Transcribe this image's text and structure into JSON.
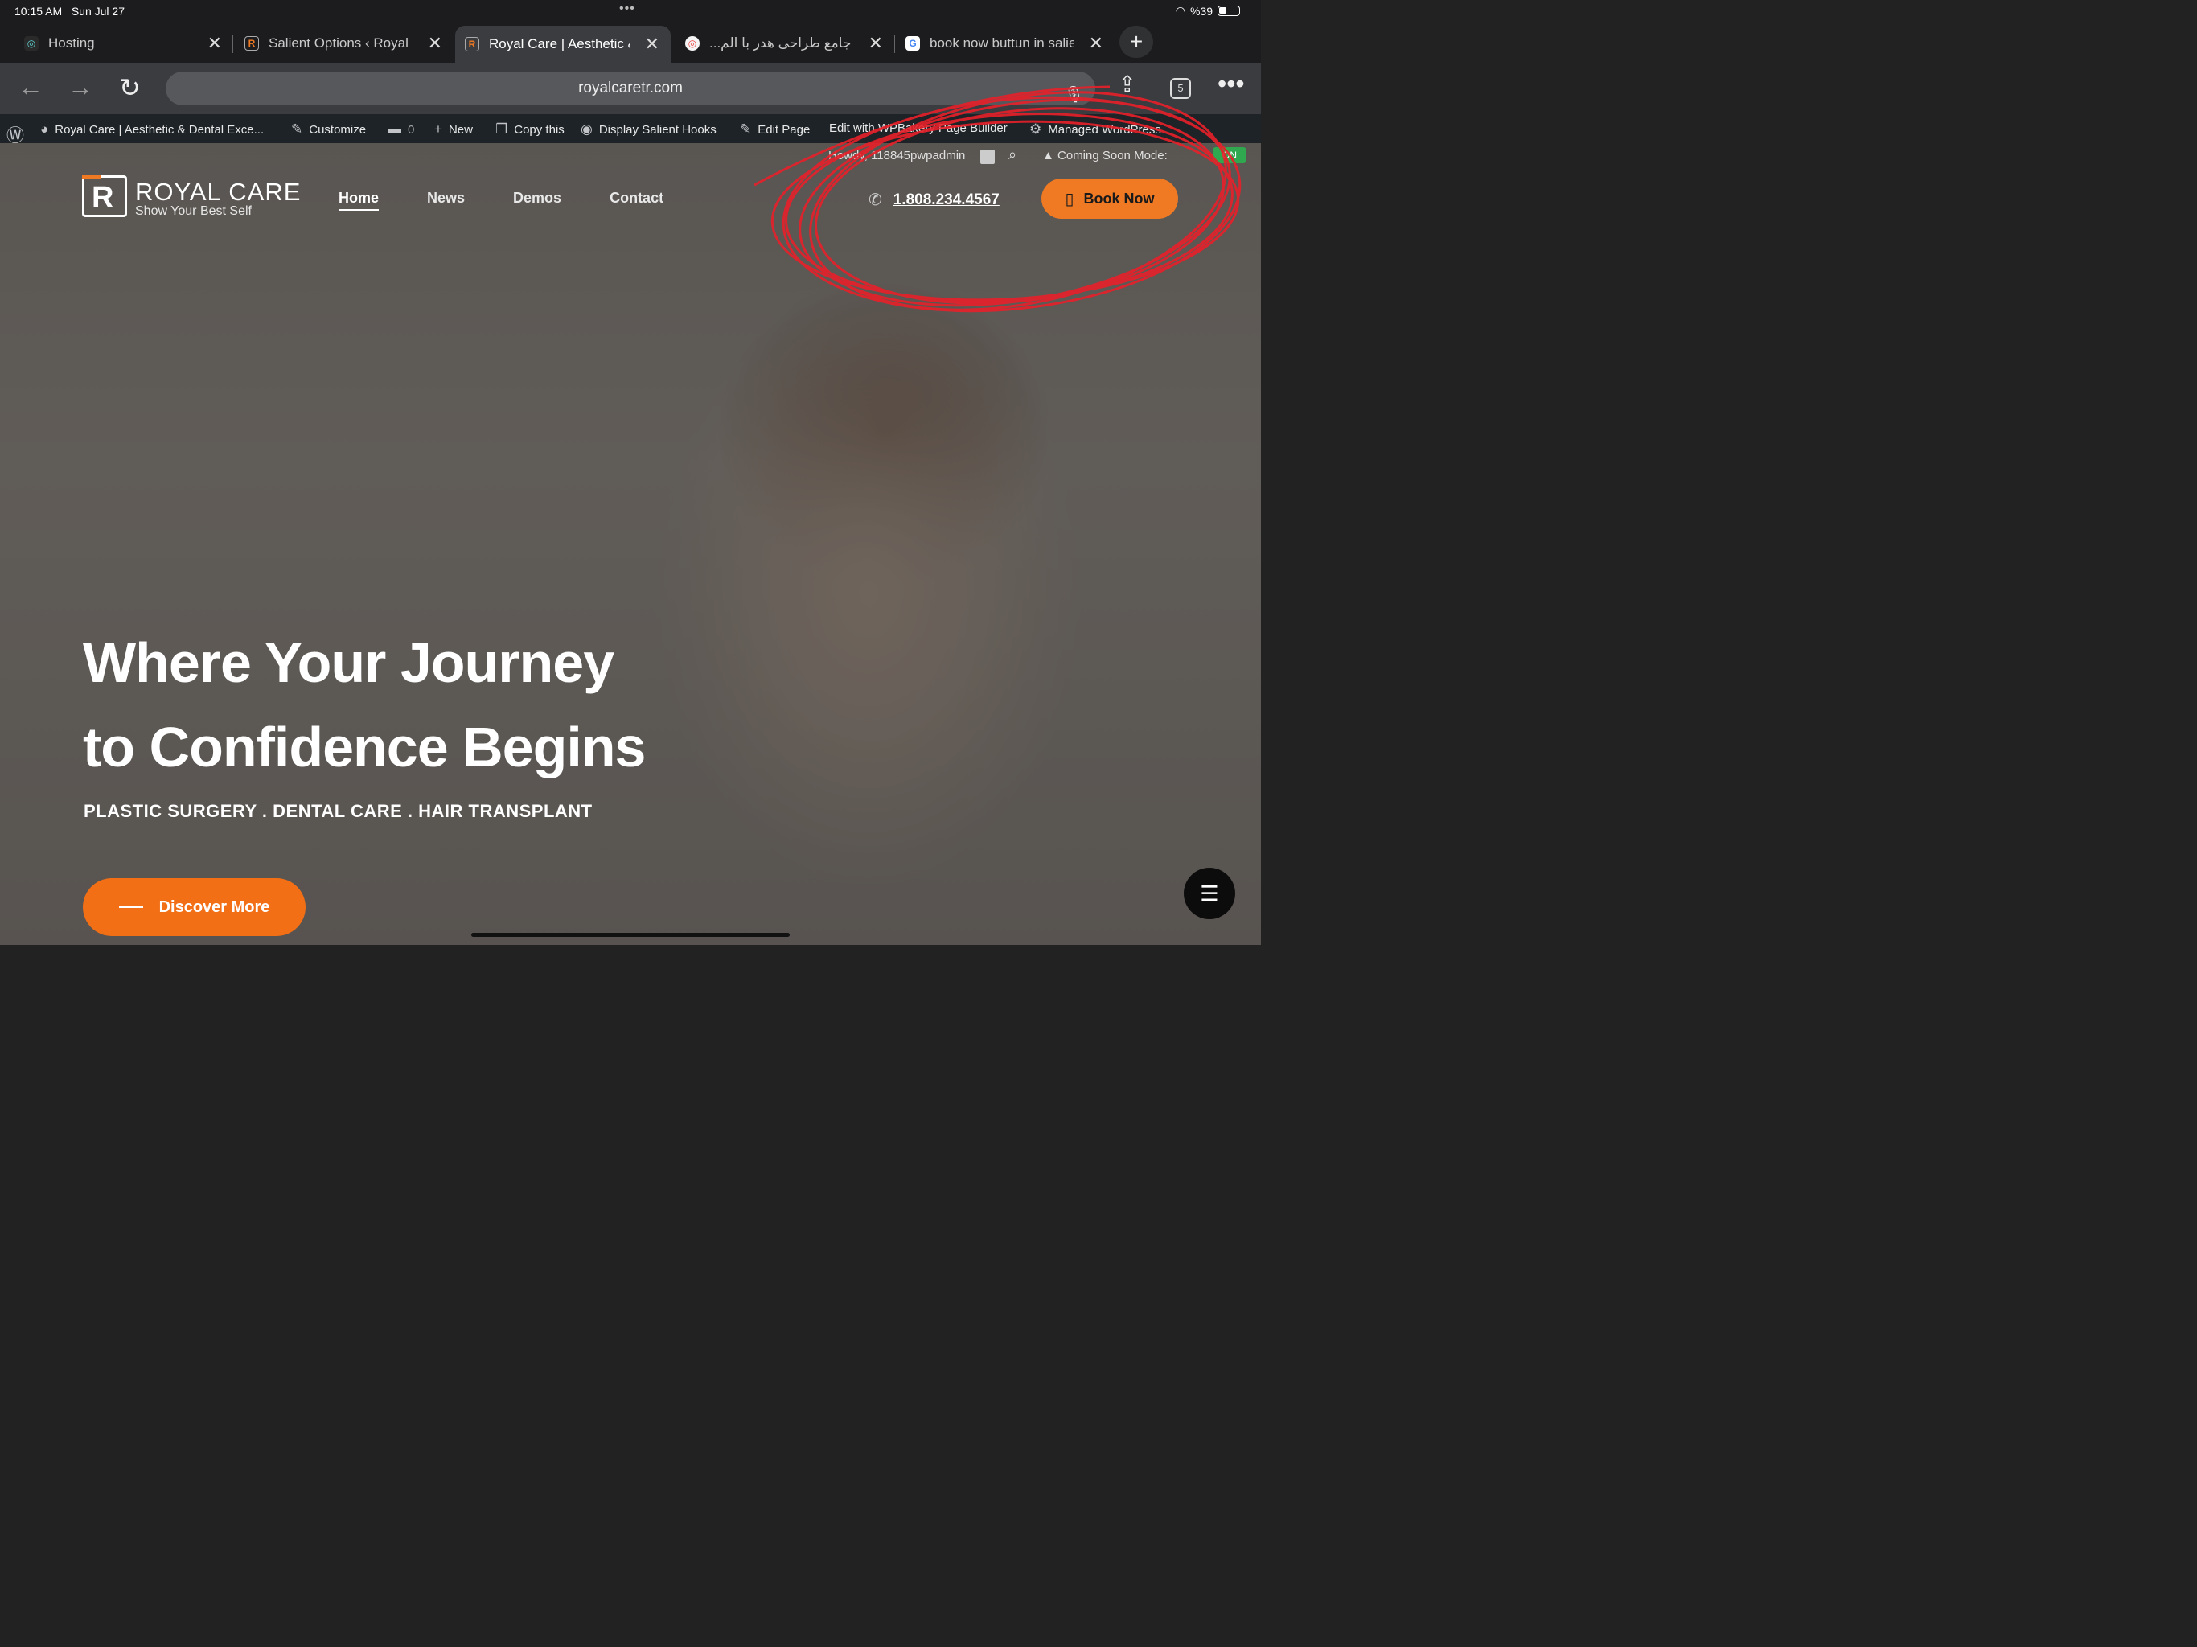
{
  "status": {
    "time": "10:15 AM",
    "date": "Sun Jul 27",
    "battery": "%39"
  },
  "tabs": [
    {
      "title": "Hosting",
      "favicon": "hosting-icon"
    },
    {
      "title": "Salient Options ‹ Royal C",
      "favicon": "royal-logo-icon"
    },
    {
      "title": "Royal Care | Aesthetic &",
      "favicon": "royal-logo-icon",
      "active": true
    },
    {
      "title": "...ش جامع طراحی هدر با الم",
      "favicon": "target-icon"
    },
    {
      "title": "book now buttun in salie",
      "favicon": "google-icon"
    }
  ],
  "browser": {
    "url": "royalcaretr.com",
    "tab_count": "5"
  },
  "wp_admin": {
    "site": "Royal Care | Aesthetic & Dental Exce...",
    "customize": "Customize",
    "comments": "0",
    "new": "New",
    "copy": "Copy this",
    "hooks": "Display Salient Hooks",
    "edit_page": "Edit Page",
    "builder": "Edit with WPBakery Page Builder",
    "managed": "Managed WordPress",
    "howdy": "Howdy, 118845pwpadmin",
    "coming_soon": "Coming Soon Mode:",
    "coming_soon_state": "ON"
  },
  "site": {
    "logo_name": "ROYAL CARE",
    "logo_tag": "Show Your Best Self",
    "nav": [
      "Home",
      "News",
      "Demos",
      "Contact"
    ],
    "phone": "1.808.234.4567",
    "book_now": "Book Now",
    "headline_1": "Where Your Journey",
    "headline_2": "to Confidence Begins",
    "subline": "PLASTIC SURGERY . DENTAL CARE . HAIR TRANSPLANT",
    "discover": "Discover More"
  },
  "colors": {
    "accent": "#f07a24",
    "annotation": "#e8202a",
    "wp_bar": "#1d2327"
  }
}
